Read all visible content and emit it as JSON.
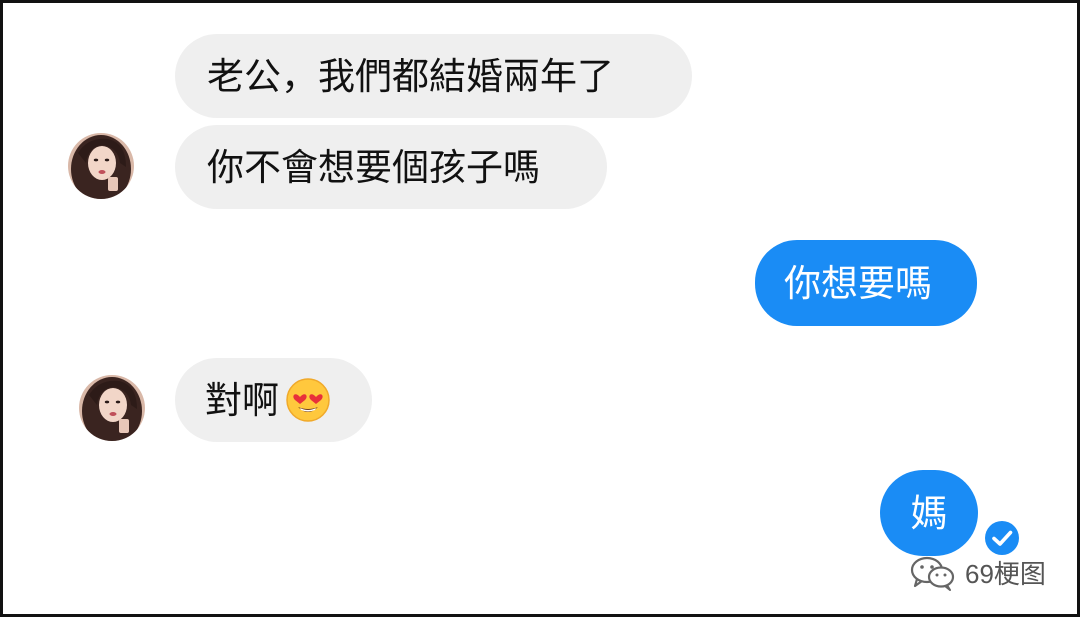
{
  "conversation": {
    "messages": [
      {
        "side": "incoming",
        "text": "老公，我們都結婚兩年了"
      },
      {
        "side": "incoming",
        "text": "你不會想要個孩子嗎"
      },
      {
        "side": "outgoing",
        "text": "你想要嗎"
      },
      {
        "side": "incoming",
        "text": "對啊",
        "emoji": "heart-eyes-emoji"
      },
      {
        "side": "outgoing",
        "text": "媽",
        "status": "read-check-icon"
      }
    ]
  },
  "watermark": {
    "icon": "wechat-icon",
    "text": "69梗图"
  },
  "colors": {
    "incoming_bubble": "#efefef",
    "outgoing_bubble": "#1a8cf5",
    "check": "#1a8cf5"
  }
}
